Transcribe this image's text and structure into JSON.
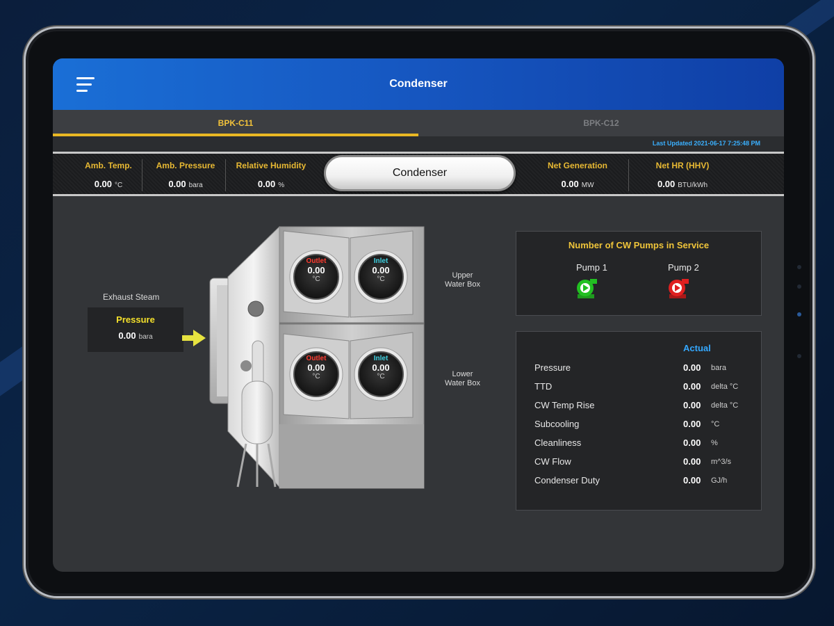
{
  "app": {
    "title": "Condenser"
  },
  "tabs": [
    {
      "label": "BPK-C11",
      "active": true
    },
    {
      "label": "BPK-C12",
      "active": false
    }
  ],
  "last_updated": "Last Updated 2021-06-17  7:25:48 PM",
  "metrics": {
    "amb_temp": {
      "label": "Amb. Temp.",
      "value": "0.00",
      "unit": "°C"
    },
    "amb_pressure": {
      "label": "Amb. Pressure",
      "value": "0.00",
      "unit": "bara"
    },
    "rel_humidity": {
      "label": "Relative Humidity",
      "value": "0.00",
      "unit": "%"
    },
    "center_button": "Condenser",
    "net_generation": {
      "label": "Net Generation",
      "value": "0.00",
      "unit": "MW"
    },
    "net_hr": {
      "label": "Net HR (HHV)",
      "value": "0.00",
      "unit": "BTU/kWh"
    }
  },
  "exhaust": {
    "label": "Exhaust Steam",
    "pressure_title": "Pressure",
    "pressure_value": "0.00",
    "pressure_unit": "bara"
  },
  "water_boxes": {
    "upper_label_1": "Upper",
    "upper_label_2": "Water Box",
    "lower_label_1": "Lower",
    "lower_label_2": "Water Box"
  },
  "gauges": {
    "upper_outlet": {
      "label": "Outlet",
      "value": "0.00",
      "unit": "°C"
    },
    "upper_inlet": {
      "label": "Inlet",
      "value": "0.00",
      "unit": "°C"
    },
    "lower_outlet": {
      "label": "Outlet",
      "value": "0.00",
      "unit": "°C"
    },
    "lower_inlet": {
      "label": "Inlet",
      "value": "0.00",
      "unit": "°C"
    }
  },
  "pumps": {
    "title": "Number of CW Pumps in Service",
    "pump1": {
      "label": "Pump 1",
      "status": "running",
      "color": "#22c022"
    },
    "pump2": {
      "label": "Pump 2",
      "status": "stopped",
      "color": "#e02020"
    }
  },
  "actual": {
    "header": "Actual",
    "rows": [
      {
        "label": "Pressure",
        "value": "0.00",
        "unit": "bara"
      },
      {
        "label": "TTD",
        "value": "0.00",
        "unit": "delta °C"
      },
      {
        "label": "CW Temp Rise",
        "value": "0.00",
        "unit": "delta °C"
      },
      {
        "label": "Subcooling",
        "value": "0.00",
        "unit": "°C"
      },
      {
        "label": "Cleanliness",
        "value": "0.00",
        "unit": "%"
      },
      {
        "label": "CW Flow",
        "value": "0.00",
        "unit": "m^3/s"
      },
      {
        "label": "Condenser Duty",
        "value": "0.00",
        "unit": "GJ/h"
      }
    ]
  },
  "colors": {
    "accent_yellow": "#e9b824",
    "appbar_blue": "#1656c0",
    "outlet_red": "#ff3b30",
    "inlet_cyan": "#3fd0e0"
  }
}
